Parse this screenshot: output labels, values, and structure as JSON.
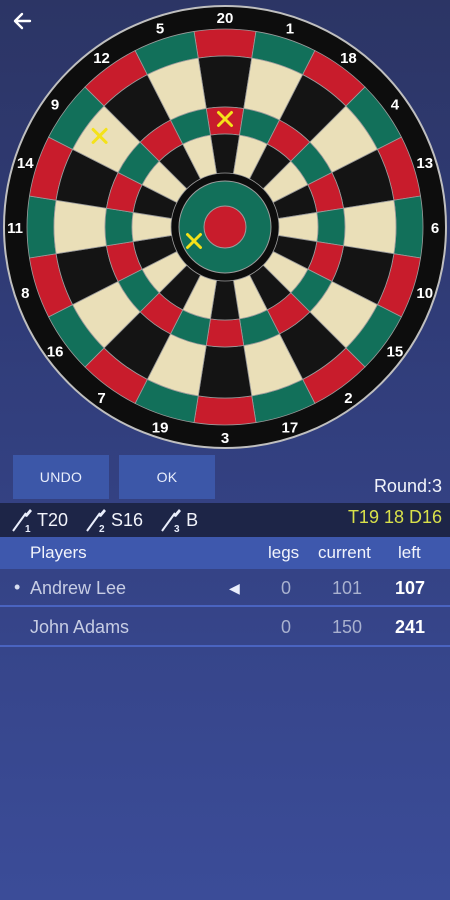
{
  "header": {
    "back_icon": "arrow-left-icon"
  },
  "board": {
    "numbers": [
      "20",
      "1",
      "18",
      "4",
      "13",
      "6",
      "10",
      "15",
      "2",
      "17",
      "3",
      "19",
      "7",
      "16",
      "8",
      "11",
      "14",
      "9",
      "12",
      "5"
    ],
    "colors": {
      "black": "#141414",
      "cream": "#eadfb8",
      "red": "#c81c2c",
      "green": "#12705a"
    },
    "markers": [
      {
        "label": "T20",
        "color": "#f4e21a"
      },
      {
        "label": "S16",
        "color": "#f4e21a"
      },
      {
        "label": "B",
        "color": "#f4e21a"
      }
    ]
  },
  "buttons": {
    "undo": "UNDO",
    "ok": "OK"
  },
  "round": "Round:3",
  "throws": [
    {
      "index": "1",
      "value": "T20"
    },
    {
      "index": "2",
      "value": "S16"
    },
    {
      "index": "3",
      "value": "B"
    }
  ],
  "checkout": "T19 18 D16",
  "checkout_color": "#d8e04a",
  "table": {
    "headers": {
      "players": "Players",
      "legs": "legs",
      "current": "current",
      "left": "left"
    },
    "rows": [
      {
        "bullet": "•",
        "name": "Andrew Lee",
        "turn_indicator": "◀",
        "legs": "0",
        "current": "101",
        "left": "107"
      },
      {
        "bullet": "",
        "name": "John Adams",
        "turn_indicator": "",
        "legs": "0",
        "current": "150",
        "left": "241"
      }
    ]
  }
}
